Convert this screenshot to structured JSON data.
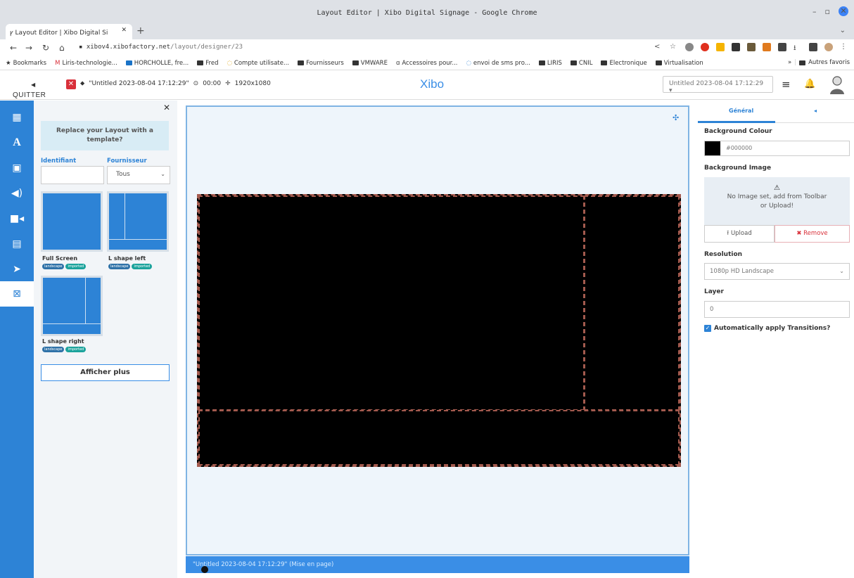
{
  "browser": {
    "window_title": "Layout Editor | Xibo Digital Signage - Google Chrome",
    "tab_title": "Layout Editor | Xibo Digital Si",
    "url_host": "xibov4.xibofactory.net",
    "url_path": "/layout/designer/23",
    "bookmarks": [
      "Bookmarks",
      "Liris-technologie...",
      "HORCHOLLE, fre...",
      "Fred",
      "Compte utilisate...",
      "Fournisseurs",
      "VMWARE",
      "Accessoires pour...",
      "envoi de sms pro...",
      "LIRIS",
      "CNIL",
      "Electronique",
      "Virtualisation"
    ],
    "bookmarks_more": "»",
    "other_bookmarks": "Autres favoris"
  },
  "topbar": {
    "quit_label": "QUITTER",
    "layout_name": "\"Untitled 2023-08-04 17:12:29\"",
    "duration": "00:00",
    "resolution": "1920x1080",
    "logo": "Xibo",
    "layout_select": "Untitled 2023-08-04 17:12:29"
  },
  "templates": {
    "banner": "Replace your Layout with a template?",
    "id_label": "Identifiant",
    "provider_label": "Fournisseur",
    "provider_value": "Tous",
    "items": [
      {
        "name": "Full Screen",
        "tags": [
          "landscape",
          "imported"
        ]
      },
      {
        "name": "L shape left",
        "tags": [
          "landscape",
          "imported"
        ]
      },
      {
        "name": "L shape right",
        "tags": [
          "landscape",
          "imported"
        ]
      }
    ],
    "more_button": "Afficher plus"
  },
  "viewer": {
    "footer": "\"Untitled 2023-08-04 17:12:29\" (Mise en page)"
  },
  "properties": {
    "tab_general": "Général",
    "bg_colour_label": "Background Colour",
    "bg_colour_value": "#000000",
    "bg_image_label": "Background Image",
    "no_image_text": "No Image set, add from Toolbar or Upload!",
    "upload_label": "Upload",
    "remove_label": "Remove",
    "resolution_label": "Resolution",
    "resolution_value": "1080p HD Landscape",
    "layer_label": "Layer",
    "layer_value": "0",
    "auto_transitions_label": "Automatically apply Transitions?"
  },
  "colors": {
    "accent": "#2d83d6",
    "danger": "#d9303a",
    "region_border": "#a35a4e"
  }
}
